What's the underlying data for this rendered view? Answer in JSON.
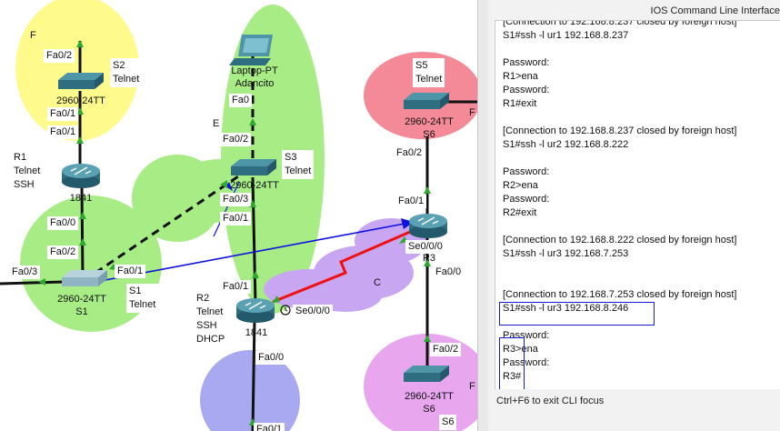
{
  "cli_panel": {
    "title": "IOS Command Line Interface",
    "lines": [
      "[Connection to 192.168.8.237 closed by foreign host]",
      "S1#ssh -l ur1 192.168.8.237",
      "",
      "Password:",
      "R1>ena",
      "Password:",
      "R1#exit",
      "",
      "[Connection to 192.168.8.237 closed by foreign host]",
      "S1#ssh -l ur2 192.168.8.222",
      "",
      "Password:",
      "R2>ena",
      "Password:",
      "R2#exit",
      "",
      "[Connection to 192.168.8.222 closed by foreign host]",
      "S1#ssh -l ur3 192.168.7.253",
      "",
      "",
      "[Connection to 192.168.7.253 closed by foreign host]",
      "S1#ssh -l ur3 192.168.8.246",
      "",
      "Password:",
      "R3>ena",
      "Password:",
      "R3#"
    ],
    "hint": "Ctrl+F6 to exit CLI focus"
  },
  "topology": {
    "devices": {
      "s2": {
        "model": "2960-24TT",
        "name": "2"
      },
      "r1": {
        "model": "1841",
        "name": "R1"
      },
      "laptop": {
        "model": "Laptop-PT",
        "name": "Adancito"
      },
      "s3": {
        "model": "2960-24TT",
        "name": "3"
      },
      "s1": {
        "model": "2960-24TT",
        "name": "S1"
      },
      "r2": {
        "model": "1841",
        "name": "R2"
      },
      "s5": {
        "model": "2960-24TT",
        "name": "S6"
      },
      "r3": {
        "model": "",
        "name": "R3"
      },
      "s6": {
        "model": "2960-24TT",
        "name": "S6"
      }
    },
    "notes": {
      "s2": "S2\nTelnet",
      "r1": "R1\nTelnet\nSSH",
      "s3": "S3\nTelnet",
      "s1": "S1\nTelnet",
      "r2": "R2\nTelnet\nSSH\nDHCP",
      "s5": "S5\nTelnet",
      "s6": "S6"
    },
    "area_labels": {
      "yellow": "F",
      "green": "E",
      "purple": "C",
      "red": "F",
      "pink": "F"
    },
    "ports": {
      "s2_fa02": "Fa0/2",
      "s2_fa01": "Fa0/1",
      "r1_fa01": "Fa0/1",
      "r1_fa00": "Fa0/0",
      "s1_fa02": "Fa0/2",
      "s1_fa03": "Fa0/3",
      "s1_fa01": "Fa0/1",
      "laptop_fa0": "Fa0",
      "s3_fa02": "Fa0/2",
      "s3_fa03": "Fa0/3",
      "s3_fa01": "Fa0/1",
      "r2_fa01": "Fa0/1",
      "r2_fa00": "Fa0/0",
      "r2_se000": "Se0/0/0",
      "s5_fa02": "Fa0/2",
      "r3_fa01": "Fa0/1",
      "r3_se000": "Se0/0/0",
      "r3_fa00": "Fa0/0",
      "s6_fa02": "Fa0/2",
      "bottom_fa01": "Fa0/1"
    }
  },
  "colors": {
    "yellow_area": "#fffa8c",
    "green_area": "#a8ec86",
    "purple_area": "#c9a6f2",
    "red_area": "#f48a98",
    "pink_area": "#e7a6ee",
    "blue_area": "#a9a9f2",
    "highlight": "#1a1ad0",
    "serial_link": "#ee1111",
    "ssh_arrow": "#1010e0"
  }
}
